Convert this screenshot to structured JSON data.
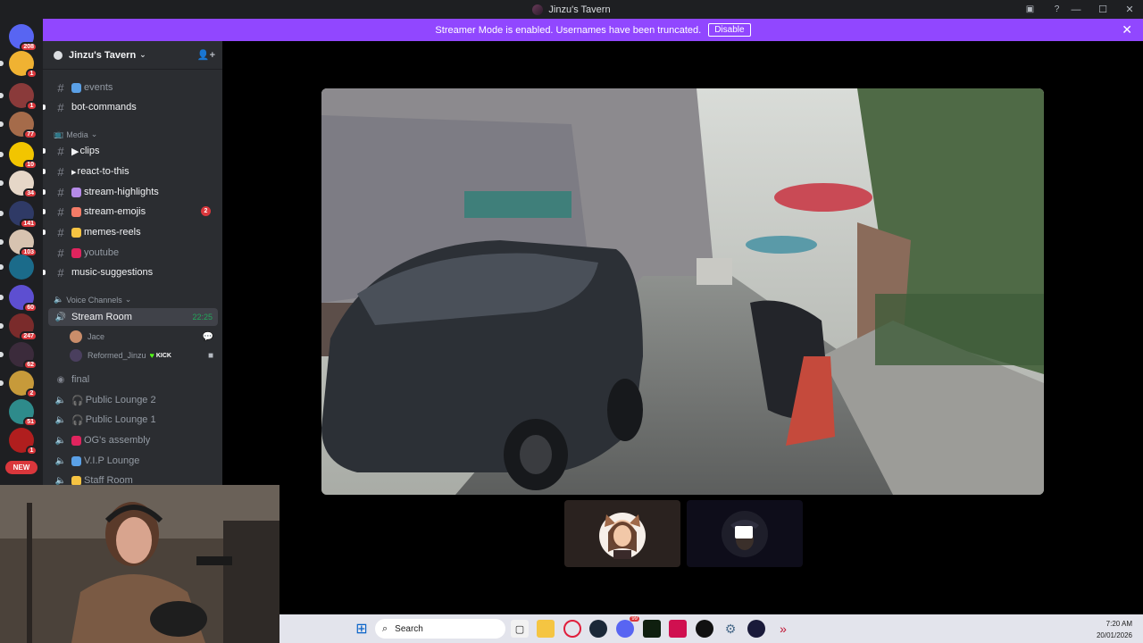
{
  "window": {
    "title": "Jinzu's Tavern",
    "controls": {
      "minimize": "—",
      "maximize": "☐",
      "close": "✕"
    }
  },
  "banner": {
    "text": "Streamer Mode is enabled. Usernames have been truncated.",
    "button": "Disable",
    "close": "✕"
  },
  "rail": {
    "servers": [
      {
        "badge": "208",
        "color": "#5865f2"
      },
      {
        "badge": "1",
        "color": "#f0b232"
      },
      {
        "badge": "1",
        "color": "#8a3a3a"
      },
      {
        "badge": "77",
        "color": "#a56b4a"
      },
      {
        "badge": "10",
        "color": "#f2c500"
      },
      {
        "badge": "34",
        "color": "#e6d7c8"
      },
      {
        "badge": "141",
        "color": "#2f3a66"
      },
      {
        "badge": "103",
        "color": "#d7c3b0"
      },
      {
        "badge": "",
        "color": "#1b6b8a"
      },
      {
        "badge": "60",
        "color": "#5d4fd1"
      },
      {
        "badge": "247",
        "color": "#7a2b2b"
      },
      {
        "badge": "62",
        "color": "#3b2b3b"
      },
      {
        "badge": "2",
        "color": "#c79a3a"
      },
      {
        "badge": "51",
        "color": "#2e8b8b"
      },
      {
        "badge": "1",
        "color": "#b01e1e"
      }
    ],
    "new_label": "NEW"
  },
  "sidebar": {
    "server_name": "Jinzu's Tavern",
    "channels_top": [
      {
        "name": "events",
        "emoji_color": "#5aa0e6",
        "bright": false,
        "unread": false
      },
      {
        "name": "bot-commands",
        "emoji_color": "",
        "bright": true,
        "unread": true
      }
    ],
    "media_category": "Media",
    "media_channels": [
      {
        "name": "clips",
        "prefix": "▶",
        "bright": true,
        "unread": true,
        "mention": ""
      },
      {
        "name": "react-to-this",
        "prefix": "▸",
        "bright": true,
        "unread": true,
        "mention": ""
      },
      {
        "name": "stream-highlights",
        "prefix": "",
        "emoji_color": "#b58ae8",
        "bright": true,
        "unread": true,
        "mention": ""
      },
      {
        "name": "stream-emojis",
        "prefix": "",
        "emoji_color": "#f47b67",
        "bright": true,
        "unread": true,
        "mention": "2"
      },
      {
        "name": "memes-reels",
        "prefix": "",
        "emoji_color": "#f6c342",
        "bright": true,
        "unread": true,
        "mention": ""
      },
      {
        "name": "youtube",
        "prefix": "",
        "emoji_color": "#e0245e",
        "bright": false,
        "unread": false,
        "mention": ""
      },
      {
        "name": "music-suggestions",
        "prefix": "",
        "emoji_color": "",
        "bright": true,
        "unread": true,
        "mention": ""
      }
    ],
    "voice_category": "Voice Channels",
    "stream_room": {
      "name": "Stream Room",
      "timer": "22:25"
    },
    "members": [
      {
        "name": "Jace",
        "color": "#c98d6a"
      },
      {
        "name": "Reformed_Jinzu",
        "color": "#4a3f5e",
        "tag": "KICK"
      }
    ],
    "voice_channels": [
      {
        "name": "final",
        "prefix": ""
      },
      {
        "name": "Public Lounge 2",
        "prefix": "🎧"
      },
      {
        "name": "Public Lounge 1",
        "prefix": "🎧"
      },
      {
        "name": "OG's assembly",
        "prefix": ""
      },
      {
        "name": "V.I.P Lounge",
        "prefix": ""
      },
      {
        "name": "Staff Room",
        "prefix": ""
      }
    ]
  },
  "taskbar": {
    "search_placeholder": "Search",
    "time": "7:20 AM",
    "date": "20/01/2026",
    "chat_badge": "99"
  }
}
